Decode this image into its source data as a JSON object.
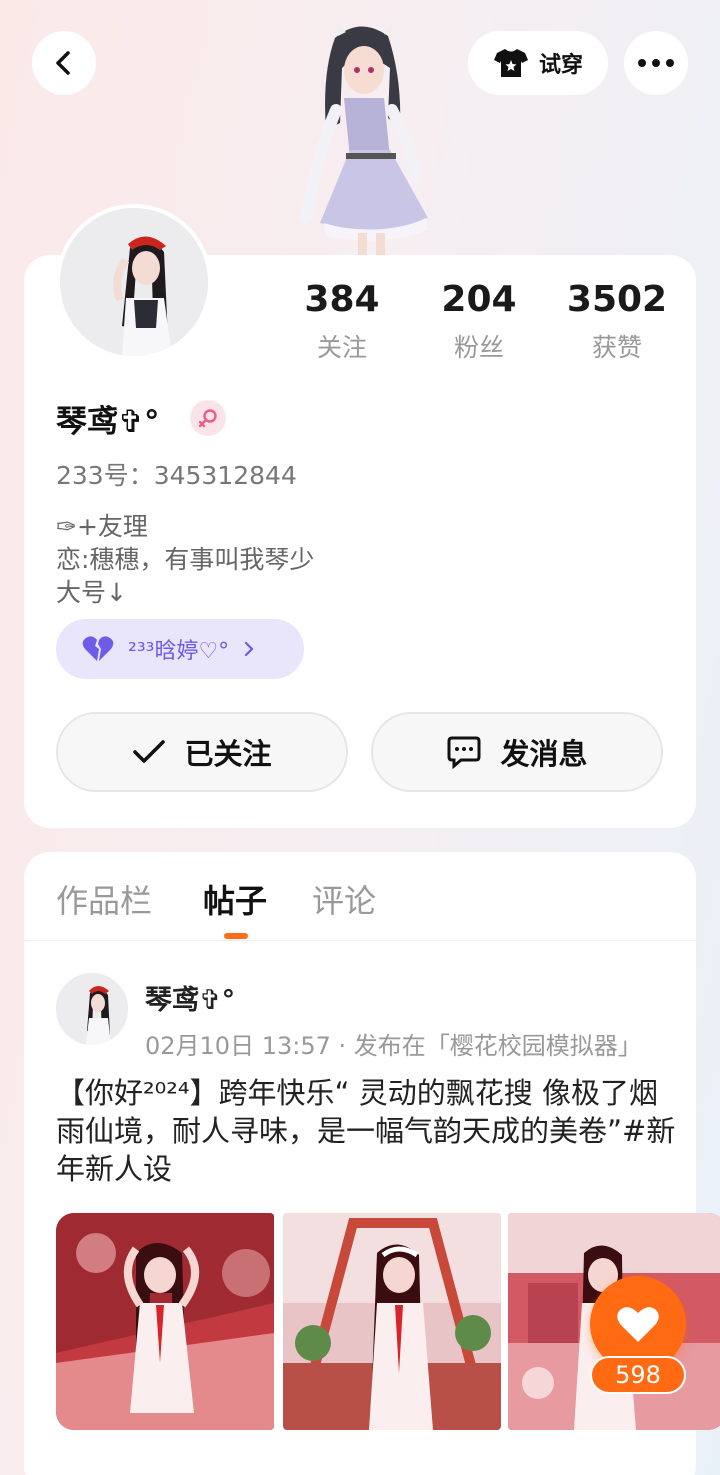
{
  "topbar": {
    "back_icon": "chevron-left-icon",
    "try_on_label": "试穿",
    "try_on_icon": "shirt-icon",
    "more_icon": "more-dots-icon"
  },
  "profile": {
    "stats": [
      {
        "value": "384",
        "label": "关注"
      },
      {
        "value": "204",
        "label": "粉丝"
      },
      {
        "value": "3502",
        "label": "获赞"
      }
    ],
    "name": "琴鸢✞°",
    "gender_icon": "female-icon",
    "uid": "233号：345312844",
    "bio_lines": [
      "✑+友理",
      "恋:穗穗，有事叫我琴少",
      "大号↓"
    ],
    "tag_label": "²³³晗婷♡°",
    "follow_label": "已关注",
    "message_label": "发消息"
  },
  "tabs": [
    {
      "label": "作品栏",
      "active": false
    },
    {
      "label": "帖子",
      "active": true
    },
    {
      "label": "评论",
      "active": false
    }
  ],
  "post": {
    "author": "琴鸢✞°",
    "meta": "02月10日 13:57 · 发布在「樱花校园模拟器」",
    "text": "【你好²⁰²⁴】跨年快乐“ 灵动的飘花搜 像极了烟雨仙境，耐人寻味，是一幅气韵天成的美卷”#新年新人设",
    "like_count": "598"
  },
  "colors": {
    "accent": "#ff6a13",
    "tag_bg": "#e9e6fb",
    "tag_text": "#6c5ce7"
  }
}
